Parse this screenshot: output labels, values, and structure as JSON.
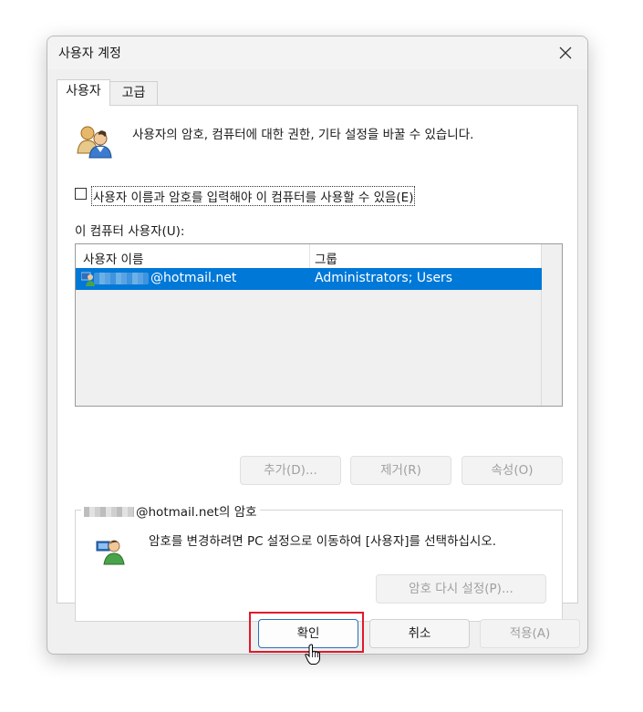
{
  "window": {
    "title": "사용자 계정"
  },
  "tabs": [
    {
      "label": "사용자"
    },
    {
      "label": "고급"
    }
  ],
  "intro_text": "사용자의 암호, 컴퓨터에 대한 권한, 기타 설정을 바꿀 수 있습니다.",
  "require_login": {
    "label": "사용자 이름과 암호를 입력해야 이 컴퓨터를 사용할 수 있음(E)",
    "checked": false
  },
  "users_list": {
    "label": "이 컴퓨터 사용자(U):",
    "columns": [
      "사용자 이름",
      "그룹"
    ],
    "rows": [
      {
        "name": "@hotmail.net",
        "group": "Administrators; Users",
        "selected": true
      }
    ]
  },
  "list_buttons": {
    "add": "추가(D)...",
    "remove": "제거(R)",
    "properties": "속성(O)"
  },
  "password_group": {
    "legend": "@hotmail.net의 암호",
    "text": "암호를 변경하려면 PC 설정으로 이동하여 [사용자]를 선택하십시오.",
    "reset_button": "암호 다시 설정(P)..."
  },
  "footer": {
    "ok": "확인",
    "cancel": "취소",
    "apply": "적용(A)"
  },
  "colors": {
    "selection": "#0078d7",
    "highlight_frame": "#e0192b",
    "ok_border": "#2c6fbb"
  }
}
